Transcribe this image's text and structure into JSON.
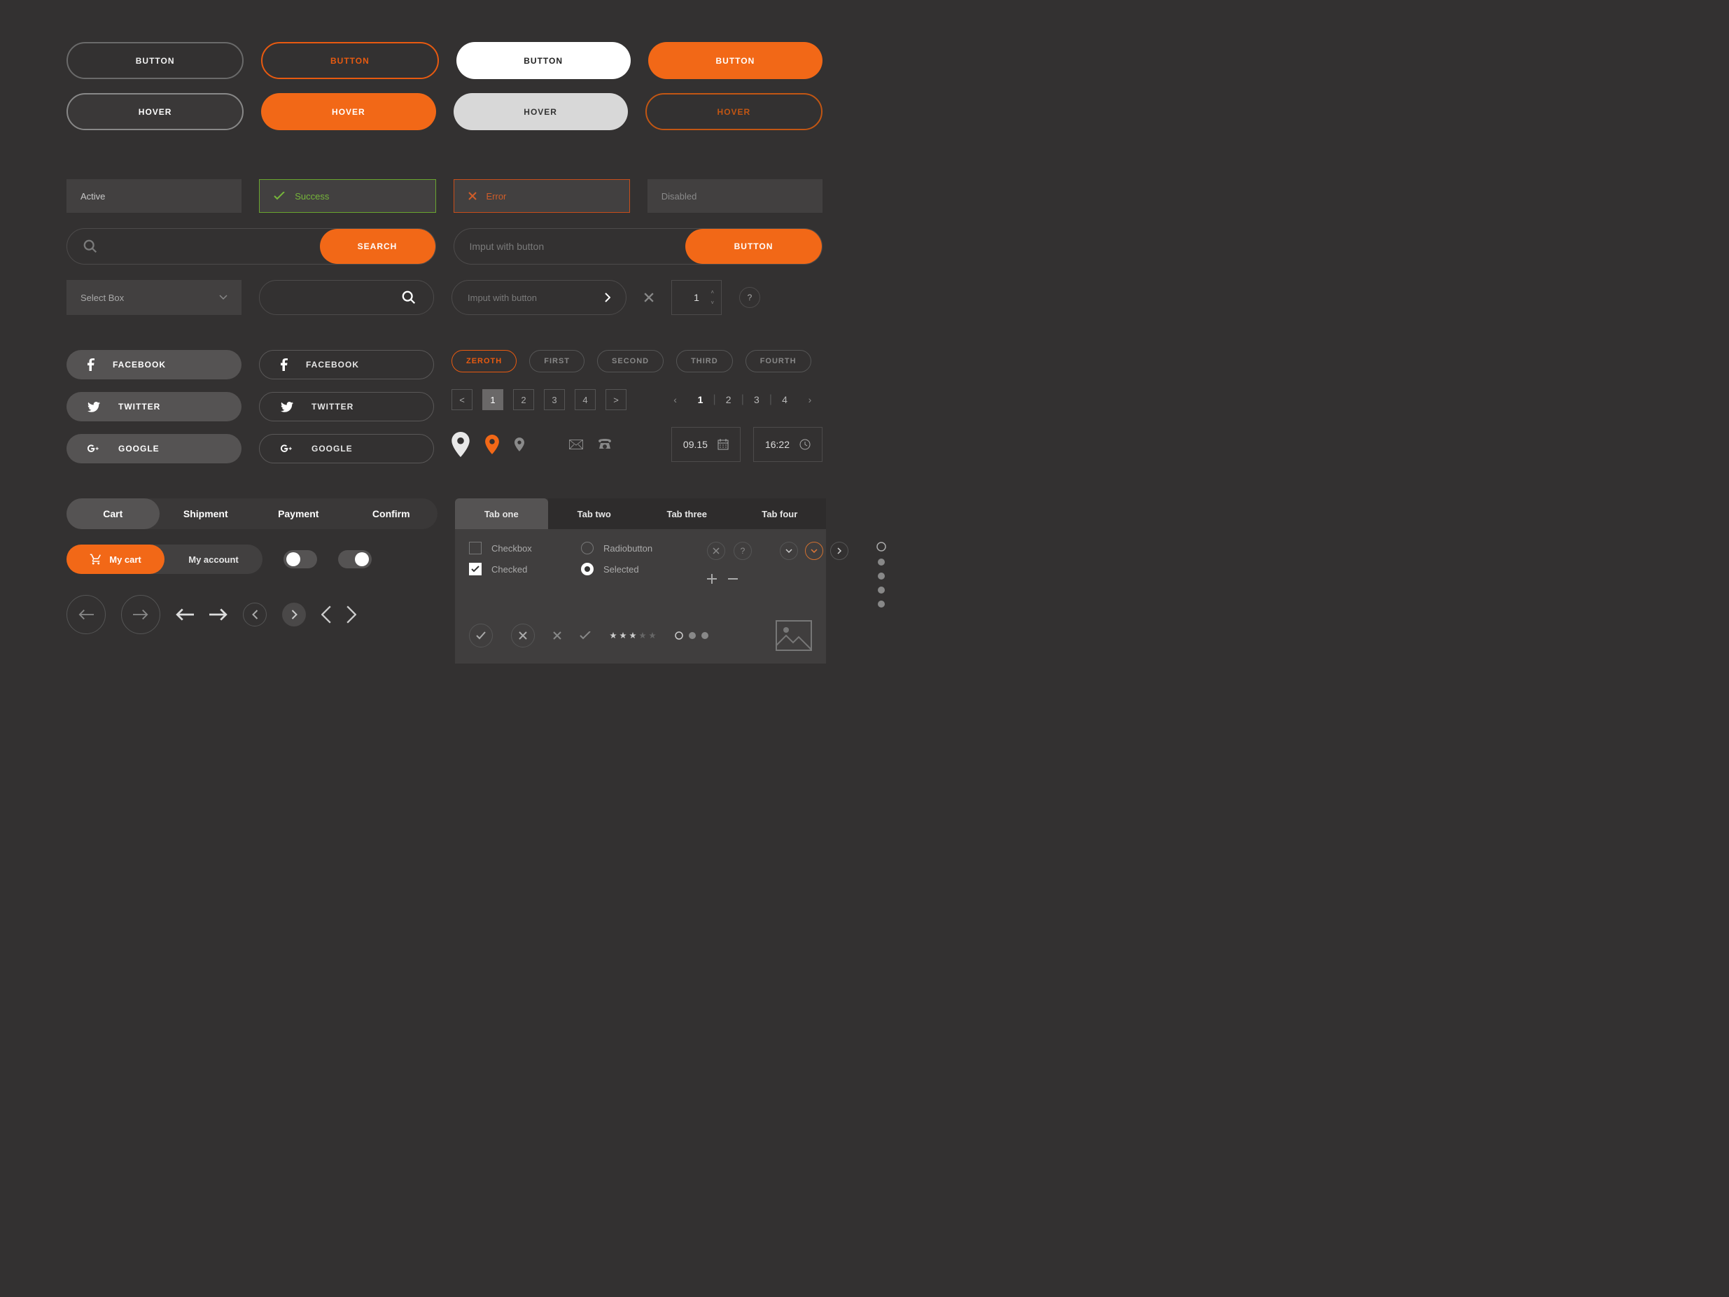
{
  "buttons": {
    "row1": [
      "BUTTON",
      "BUTTON",
      "BUTTON",
      "BUTTON"
    ],
    "row2": [
      "HOVER",
      "HOVER",
      "HOVER",
      "HOVER"
    ]
  },
  "inputs": {
    "active": "Active",
    "success": "Success",
    "error": "Error",
    "disabled": "Disabled"
  },
  "search": {
    "button": "SEARCH",
    "inputWithButton_ph": "Imput with button",
    "buttonLabel": "BUTTON"
  },
  "select": {
    "label": "Select Box"
  },
  "roundAction_ph": "Imput with button",
  "stepper": {
    "value": "1"
  },
  "help": "?",
  "social": {
    "facebook": "FACEBOOK",
    "twitter": "TWITTER",
    "google": "GOOGLE"
  },
  "chips": [
    "ZEROTH",
    "FIRST",
    "SECOND",
    "THIRD",
    "FOURTH"
  ],
  "pagerSquare": [
    "<",
    "1",
    "2",
    "3",
    "4",
    ">"
  ],
  "pagerFlat": [
    "1",
    "2",
    "3",
    "4"
  ],
  "date": "09.15",
  "time": "16:22",
  "stepTabs": [
    "Cart",
    "Shipment",
    "Payment",
    "Confirm"
  ],
  "tabs": [
    "Tab one",
    "Tab two",
    "Tab three",
    "Tab four"
  ],
  "check": {
    "unchecked": "Checkbox",
    "checked": "Checked"
  },
  "radio": {
    "unchecked": "Radiobutton",
    "checked": "Selected"
  },
  "cartPill": {
    "cart": "My cart",
    "account": "My account"
  }
}
